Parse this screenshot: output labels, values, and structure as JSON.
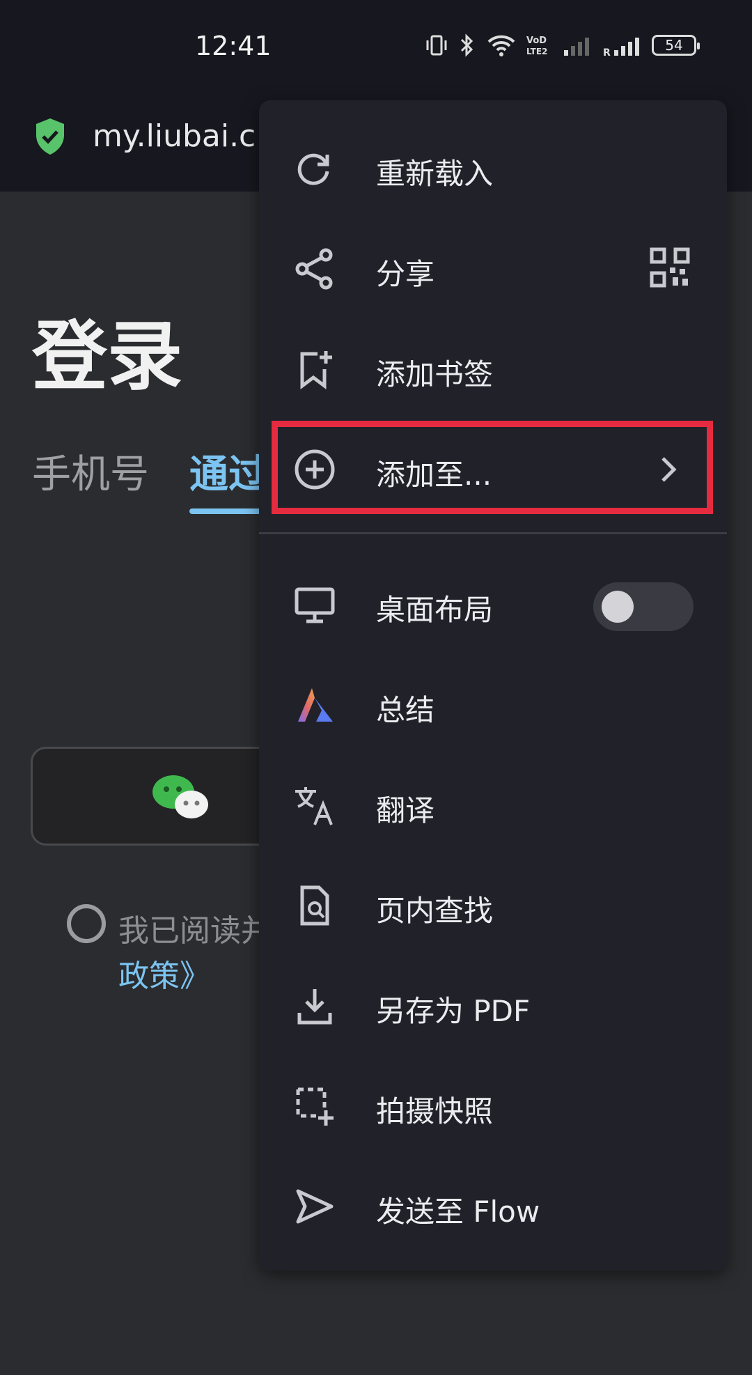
{
  "status_bar": {
    "time": "12:41",
    "battery": "54"
  },
  "address_bar": {
    "url": "my.liubai.c"
  },
  "page": {
    "title": "登录",
    "tabs": [
      "手机号",
      "通过"
    ],
    "agree_text": "我已阅读并",
    "agree_link": "政策》"
  },
  "menu": {
    "items": [
      {
        "label": "重新载入",
        "icon": "reload-icon"
      },
      {
        "label": "分享",
        "icon": "share-icon"
      },
      {
        "label": "添加书签",
        "icon": "bookmark-add-icon"
      },
      {
        "label": "添加至...",
        "icon": "add-circle-icon"
      },
      {
        "label": "桌面布局",
        "icon": "desktop-icon",
        "toggle": false
      },
      {
        "label": "总结",
        "icon": "summary-icon"
      },
      {
        "label": "翻译",
        "icon": "translate-icon"
      },
      {
        "label": "页内查找",
        "icon": "find-in-page-icon"
      },
      {
        "label": "另存为 PDF",
        "icon": "download-icon"
      },
      {
        "label": "拍摄快照",
        "icon": "screenshot-icon"
      },
      {
        "label": "发送至 Flow",
        "icon": "send-icon"
      }
    ]
  },
  "colors": {
    "accent": "#7cc4f2",
    "highlight": "#e42b3f",
    "menu_bg": "#212129",
    "page_bg": "#2b2c2f"
  }
}
